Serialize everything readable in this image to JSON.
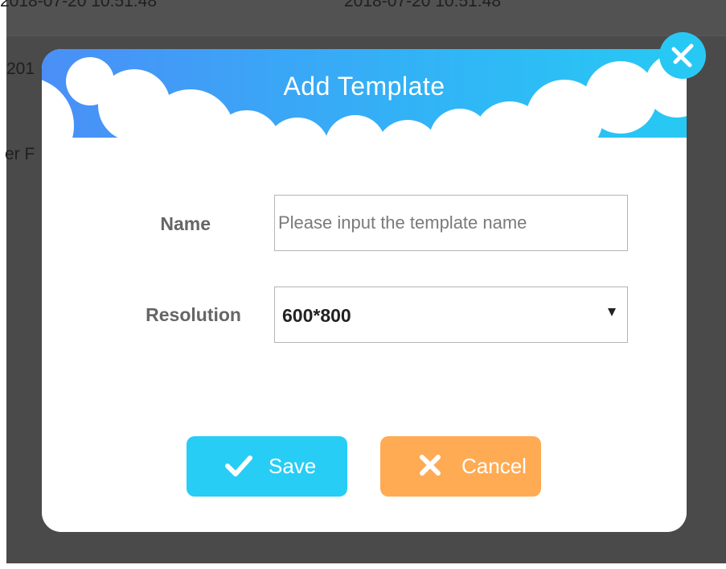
{
  "background": {
    "timestamp_1": "2018-07-20 10:51:48",
    "timestamp_2": "2018-07-20 10:51:48",
    "row2_text": "201",
    "row3_text": "er F"
  },
  "dialog": {
    "title": "Add Template",
    "close_icon": "close-icon",
    "fields": {
      "name": {
        "label": "Name",
        "value": "",
        "placeholder": "Please input the template name"
      },
      "resolution": {
        "label": "Resolution",
        "selected": "600*800",
        "arrow_icon": "dropdown-arrow-icon"
      }
    },
    "buttons": {
      "save_label": "Save",
      "save_icon": "checkmark-icon",
      "cancel_label": "Cancel",
      "cancel_icon": "x-icon"
    }
  },
  "colors": {
    "header_gradient_start": "#4a8ff7",
    "header_gradient_end": "#27c9f4",
    "save_button": "#27cdf5",
    "cancel_button": "#ffab54",
    "backdrop": "#4a4a4a",
    "label_text": "#666666"
  }
}
